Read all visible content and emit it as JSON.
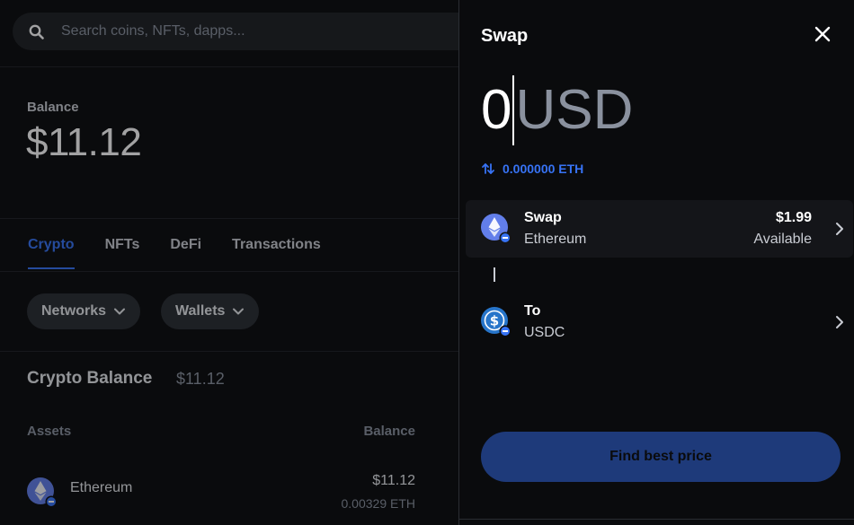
{
  "search": {
    "placeholder": "Search coins, NFTs, dapps..."
  },
  "balance": {
    "label": "Balance",
    "value": "$11.12"
  },
  "tabs": [
    {
      "label": "Crypto",
      "active": true
    },
    {
      "label": "NFTs",
      "active": false
    },
    {
      "label": "DeFi",
      "active": false
    },
    {
      "label": "Transactions",
      "active": false
    }
  ],
  "filters": {
    "networks": "Networks",
    "wallets": "Wallets"
  },
  "crypto_balance": {
    "title": "Crypto Balance",
    "value": "$11.12"
  },
  "assets_table": {
    "col_assets": "Assets",
    "col_balance": "Balance",
    "rows": [
      {
        "name": "Ethereum",
        "usd": "$11.12",
        "amount": "0.00329 ETH",
        "icon": "ethereum-icon"
      }
    ]
  },
  "swap": {
    "title": "Swap",
    "amount": "0",
    "unit": "USD",
    "conversion": "0.000000 ETH",
    "from": {
      "label": "Swap",
      "asset": "Ethereum",
      "amount": "$1.99",
      "available": "Available"
    },
    "to": {
      "label": "To",
      "asset": "USDC"
    },
    "cta": "Find best price"
  },
  "colors": {
    "accent": "#3773f5",
    "background": "#0a0b0d",
    "cta_background": "#1e3a7a",
    "ethereum": "#627eea",
    "usdc": "#2775ca"
  }
}
